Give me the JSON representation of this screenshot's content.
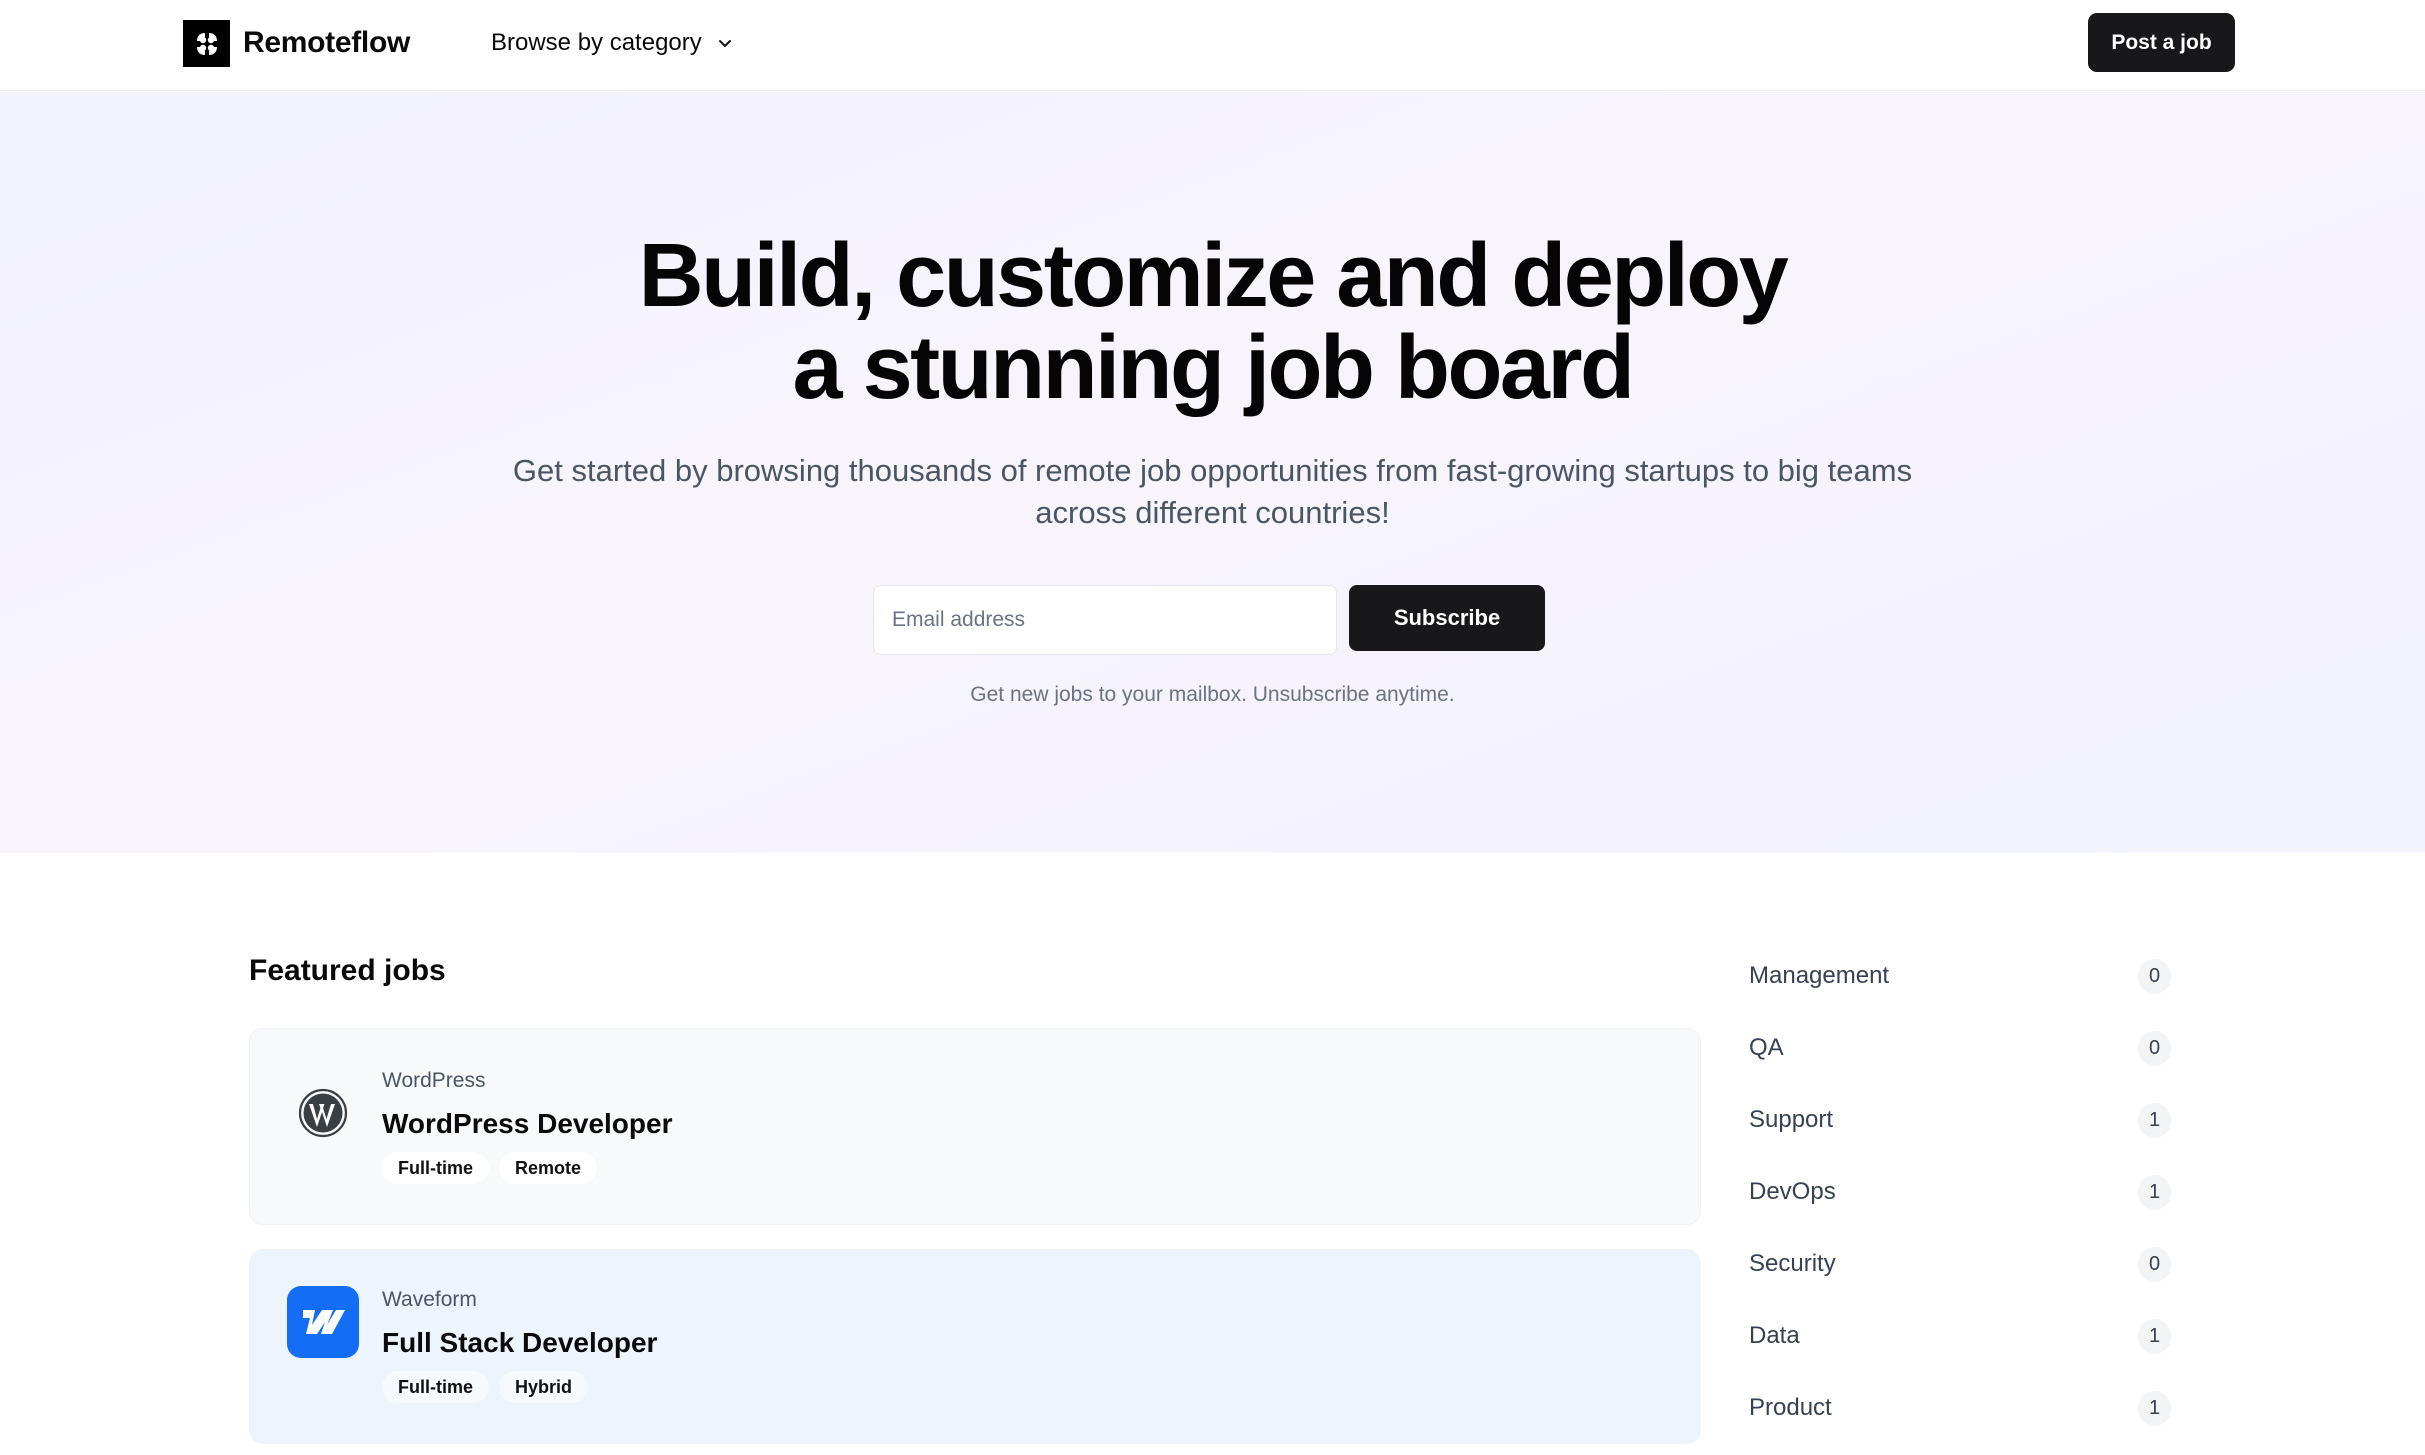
{
  "nav": {
    "brand": "Remoteflow",
    "logo_icon": "flower-logo-icon",
    "browse_label": "Browse by category",
    "browse_icon": "chevron-down-icon",
    "post_job_label": "Post a job"
  },
  "hero": {
    "title_line1": "Build, customize and deploy",
    "title_line2": "a stunning job board",
    "subtitle": "Get started by browsing thousands of remote job opportunities from fast-growing startups to big teams across different countries!",
    "email_placeholder": "Email address",
    "email_value": "",
    "subscribe_label": "Subscribe",
    "helper_text": "Get new jobs to your mailbox. Unsubscribe anytime."
  },
  "featured": {
    "title": "Featured jobs",
    "jobs": [
      {
        "company": "WordPress",
        "title": "WordPress Developer",
        "logo_icon": "wordpress-logo-icon",
        "tags": [
          "Full-time",
          "Remote"
        ]
      },
      {
        "company": "Waveform",
        "title": "Full Stack Developer",
        "logo_icon": "webflow-logo-icon",
        "tags": [
          "Full-time",
          "Hybrid"
        ]
      }
    ]
  },
  "categories": [
    {
      "label": "Management",
      "count": "0"
    },
    {
      "label": "QA",
      "count": "0"
    },
    {
      "label": "Support",
      "count": "1"
    },
    {
      "label": "DevOps",
      "count": "1"
    },
    {
      "label": "Security",
      "count": "0"
    },
    {
      "label": "Data",
      "count": "1"
    },
    {
      "label": "Product",
      "count": "1"
    }
  ],
  "colors": {
    "primary_button": "#18181b",
    "waveform_blue": "#146ef5",
    "card_bg": "#f8f9fb",
    "card_highlight_bg": "#eef4fe"
  }
}
